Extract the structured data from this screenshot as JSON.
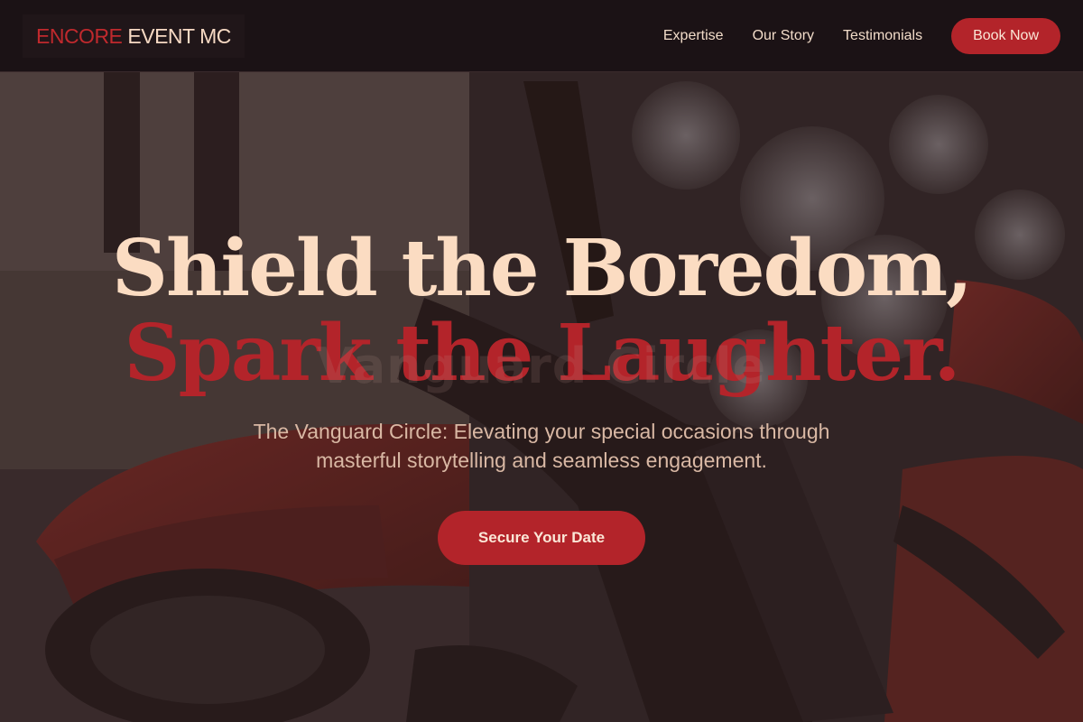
{
  "brand": {
    "logo_accent": "ENCORE",
    "logo_rest": "EVENT MC"
  },
  "nav": {
    "links": [
      {
        "label": "Expertise"
      },
      {
        "label": "Our Story"
      },
      {
        "label": "Testimonials"
      }
    ],
    "cta_label": "Book Now"
  },
  "hero": {
    "headline_line1": "Shield the Boredom,",
    "headline_line2": "Spark the Laughter.",
    "ghost_text": "Vanguard Circle",
    "subtitle": "The Vanguard Circle: Elevating your special occasions through masterful storytelling and seamless engagement.",
    "cta_label": "Secure Your Date",
    "background_image": "motorcycle-handlebar-photo"
  },
  "colors": {
    "accent": "#b3242a",
    "headline_light": "#fbdcc2",
    "nav_bg": "#1b1215",
    "text_light": "#f2dcc9",
    "subtitle": "#d9b8a4"
  }
}
